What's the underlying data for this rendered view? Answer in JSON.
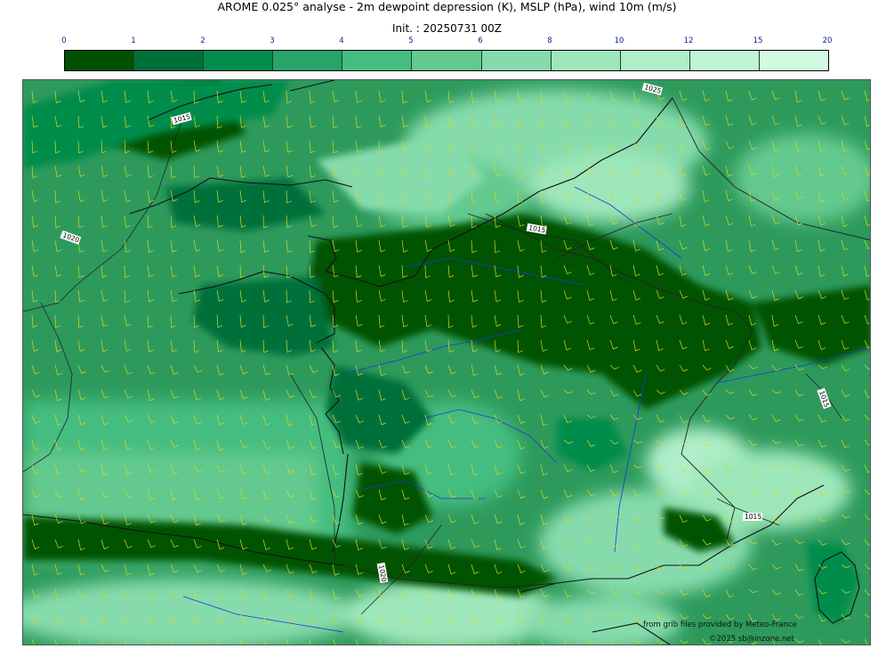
{
  "header": {
    "title": "AROME 0.025° analyse - 2m dewpoint depression (K), MSLP (hPa), wind 10m (m/s)",
    "subtitle": "Init. : 20250731 00Z"
  },
  "colorbar": {
    "ticks": [
      "0",
      "1",
      "2",
      "3",
      "4",
      "5",
      "6",
      "8",
      "10",
      "12",
      "15",
      "20"
    ],
    "colors": [
      "#005200",
      "#00703a",
      "#048c4c",
      "#26a46a",
      "#45bd80",
      "#64c98e",
      "#86dbac",
      "#9ee7ba",
      "#afeec8",
      "#c0f4d6",
      "#d2f9e2"
    ]
  },
  "map": {
    "isobar_labels": [
      "1015",
      "1020",
      "1025",
      "1015",
      "1015",
      "1020",
      "1015"
    ],
    "colors": {
      "sea_base": "#2d9a5c",
      "coastline": "#111111",
      "rivers": "#1a3adb",
      "wind_barbs": "#d8d820",
      "isobars": "#222222"
    }
  },
  "credits": {
    "source": "from grib files provided by Meteo-France",
    "copyright": "©2025 sb@inzone.net"
  }
}
